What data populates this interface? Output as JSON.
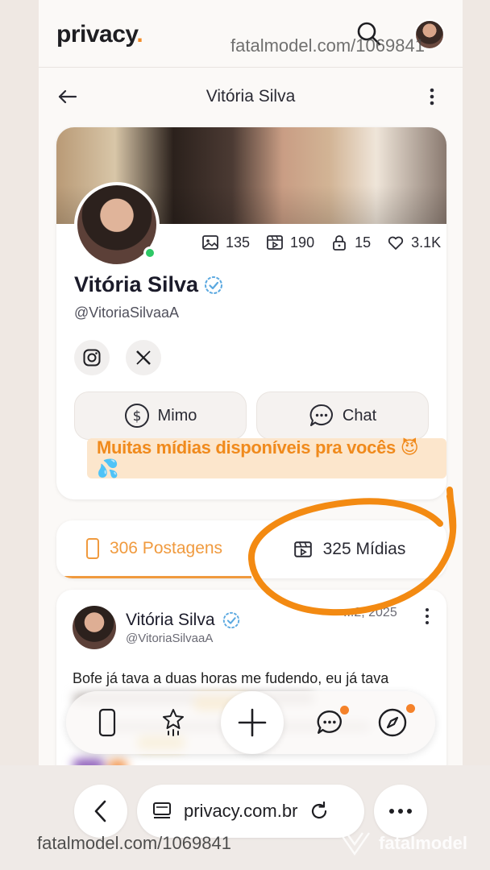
{
  "header": {
    "logo_text": "privacy",
    "logo_dot": ".",
    "watermark": "fatalmodel.com/1069841"
  },
  "subheader": {
    "title": "Vitória Silva"
  },
  "profile": {
    "name": "Vitória Silva",
    "handle": "@VitoriaSilvaaA",
    "verified": true,
    "online": true,
    "stats": {
      "images": "135",
      "videos": "190",
      "locked": "15",
      "likes": "3.1K"
    },
    "socials": [
      "instagram-icon",
      "x-icon"
    ],
    "buttons": {
      "mimo": "Mimo",
      "chat": "Chat"
    },
    "promo_text": "Muitas mídias disponíveis pra vocês 😈💦"
  },
  "tabs": {
    "posts": "306 Postagens",
    "media": "325 Mídias",
    "active": "posts"
  },
  "post": {
    "name": "Vitória Silva",
    "handle": "@VitoriaSilvaaA",
    "date": "...2, 2025",
    "text": "Bofe já tava a duas horas me fudendo, eu já tava"
  },
  "bottom_nav": {
    "items": [
      "phone-icon",
      "star-icon",
      "plus-icon",
      "chat-icon",
      "compass-icon"
    ]
  },
  "browser": {
    "url": "privacy.com.br",
    "watermark": "fatalmodel.com/1069841",
    "watermark_logo": "fatalmodel"
  },
  "colors": {
    "accent": "#f09a3e",
    "promo": "#f08a1c",
    "verified": "#5aa8e0",
    "online": "#2ec866",
    "annotation": "#f38a12"
  }
}
